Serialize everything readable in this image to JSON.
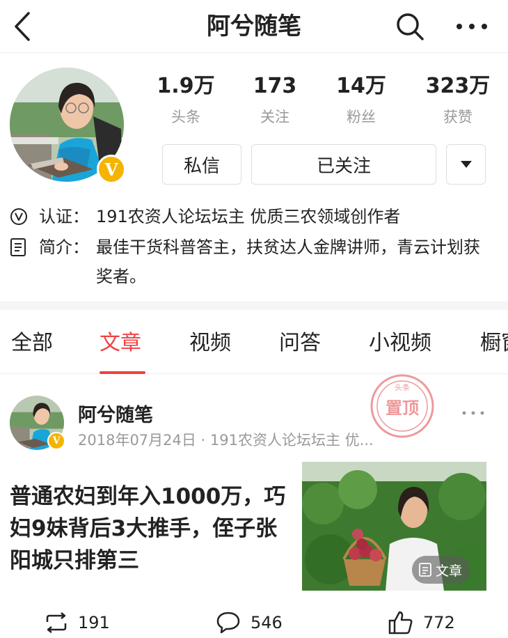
{
  "header": {
    "title": "阿兮随笔",
    "back_icon": "back-arrow-icon",
    "search_icon": "search-icon",
    "more_icon": "more-dots-icon"
  },
  "profile": {
    "verified_badge": "V",
    "stats": [
      {
        "value": "1.9万",
        "label": "头条"
      },
      {
        "value": "173",
        "label": "关注"
      },
      {
        "value": "14万",
        "label": "粉丝"
      },
      {
        "value": "323万",
        "label": "获赞"
      }
    ],
    "buttons": {
      "message": "私信",
      "follow": "已关注"
    },
    "certification_label": "认证：",
    "certification": "191农资人论坛坛主 优质三农领域创作者",
    "intro_label": "简介：",
    "intro": "最佳干货科普答主，扶贫达人金牌讲师，青云计划获奖者。"
  },
  "tabs": [
    "全部",
    "文章",
    "视频",
    "问答",
    "小视频",
    "橱窗"
  ],
  "active_tab": "文章",
  "post": {
    "author": "阿兮随笔",
    "verified_badge": "V",
    "meta": "2018年07月24日 · 191农资人论坛坛主 优...",
    "stamp_text": "置顶",
    "stamp_subtext": "头条",
    "title": "普通农妇到年入1000万，巧妇9妹背后3大推手，侄子张阳城只排第三",
    "thumb_tag": "文章",
    "actions": {
      "share": "191",
      "comment": "546",
      "like": "772"
    }
  },
  "colors": {
    "accent": "#f04142",
    "badge": "#f4b400",
    "muted": "#999999"
  }
}
